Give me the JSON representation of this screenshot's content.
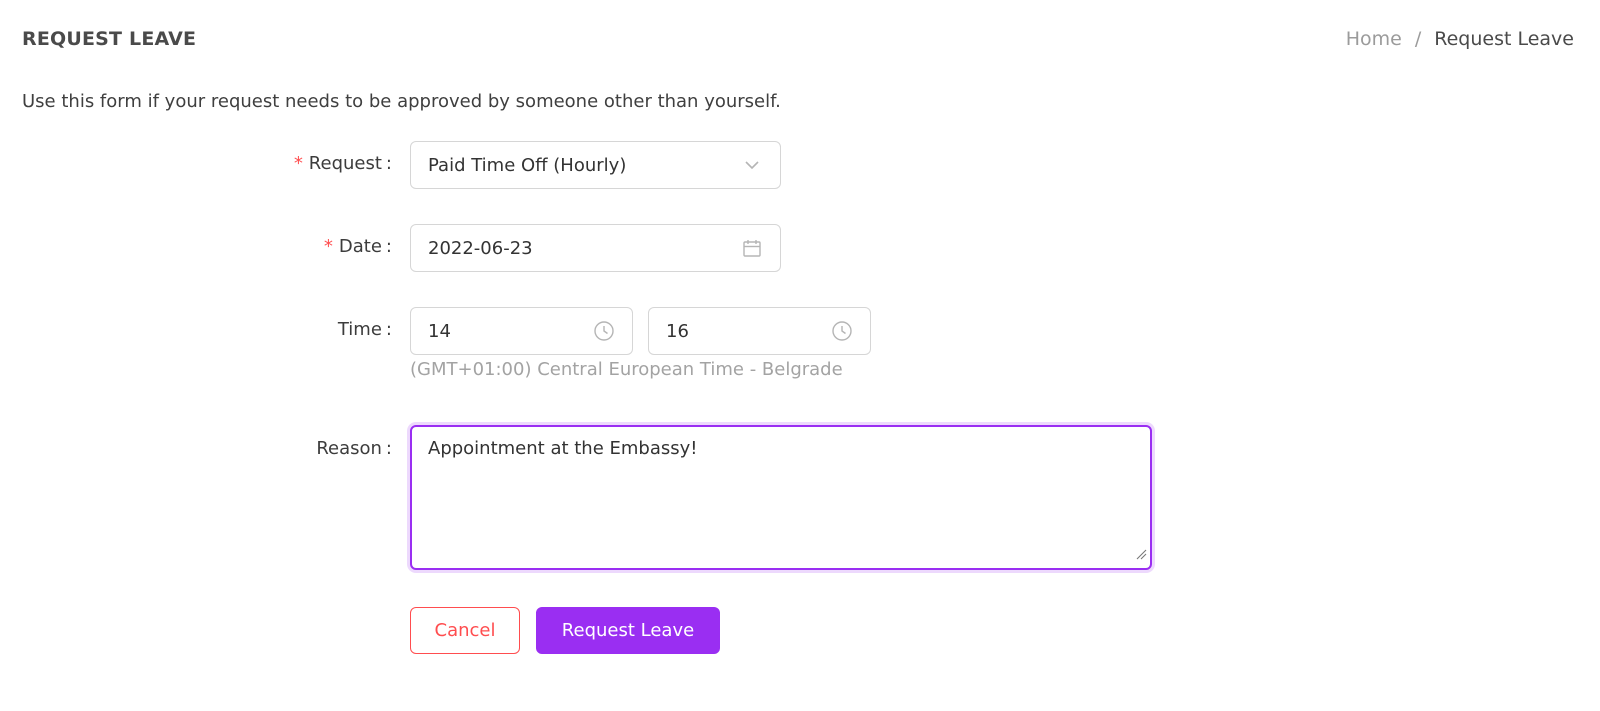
{
  "header": {
    "title": "REQUEST LEAVE",
    "breadcrumb": {
      "home": "Home",
      "separator": "/",
      "current": "Request Leave"
    }
  },
  "intro_text": "Use this form if your request needs to be approved by someone other than yourself.",
  "form": {
    "request": {
      "label": "Request",
      "required_mark": "*",
      "colon": ":",
      "value": "Paid Time Off (Hourly)",
      "icon": "chevron-down-icon"
    },
    "date": {
      "label": "Date",
      "required_mark": "*",
      "colon": ":",
      "value": "2022-06-23",
      "icon": "calendar-icon"
    },
    "time": {
      "label": "Time",
      "colon": ":",
      "start": "14",
      "end": "16",
      "icon": "clock-icon",
      "timezone": "(GMT+01:00) Central European Time - Belgrade"
    },
    "reason": {
      "label": "Reason",
      "colon": ":",
      "value": "Appointment at the Embassy!"
    }
  },
  "buttons": {
    "cancel": "Cancel",
    "submit": "Request Leave"
  },
  "colors": {
    "accent": "#9a2ef2",
    "danger": "#ff4d4f",
    "border": "#d6d6d6",
    "muted": "#a3a3a3"
  }
}
